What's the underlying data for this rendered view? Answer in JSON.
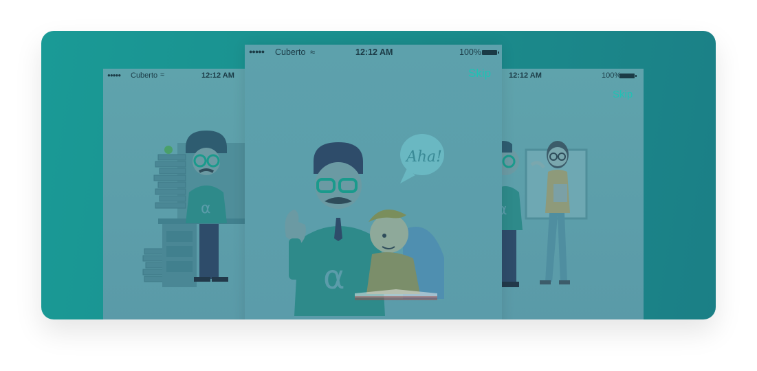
{
  "screens": {
    "left": {
      "carrier": "Cuberto",
      "time": "12:12 AM"
    },
    "center": {
      "carrier": "Cuberto",
      "time": "12:12 AM",
      "battery": "100%",
      "skip_label": "Skip",
      "speech_bubble": "Aha!"
    },
    "right": {
      "time": "12:12 AM",
      "battery": "100%",
      "skip_label": "Skip"
    }
  },
  "colors": {
    "card_background": "#1b8c8c",
    "screen_overlay": "#5b9caa",
    "accent": "#1fc2b4",
    "status_text": "#1b3b46"
  }
}
